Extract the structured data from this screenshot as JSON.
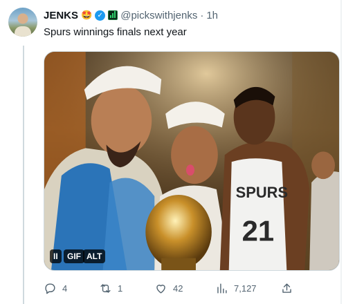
{
  "tweet": {
    "author_name": "JENKS",
    "author_emoji": "🤩",
    "verified_mark": "✓",
    "handle": "@pickswithjenks",
    "separator": "·",
    "time": "1h",
    "text": "Spurs winnings finals next year"
  },
  "media": {
    "gif_controls": {
      "pause_glyph": "II",
      "gif_label": "GIF",
      "alt_label": "ALT"
    },
    "jersey_text": "SPURS",
    "jersey_number": "21"
  },
  "actions": {
    "reply_count": "4",
    "retweet_count": "1",
    "like_count": "42",
    "view_count": "7,127",
    "icons": [
      "reply-icon",
      "retweet-icon",
      "like-icon",
      "views-icon",
      "share-icon"
    ]
  },
  "colors": {
    "accent": "#1d9bf0",
    "secondary_text": "#536471",
    "border": "#cfd9de"
  }
}
